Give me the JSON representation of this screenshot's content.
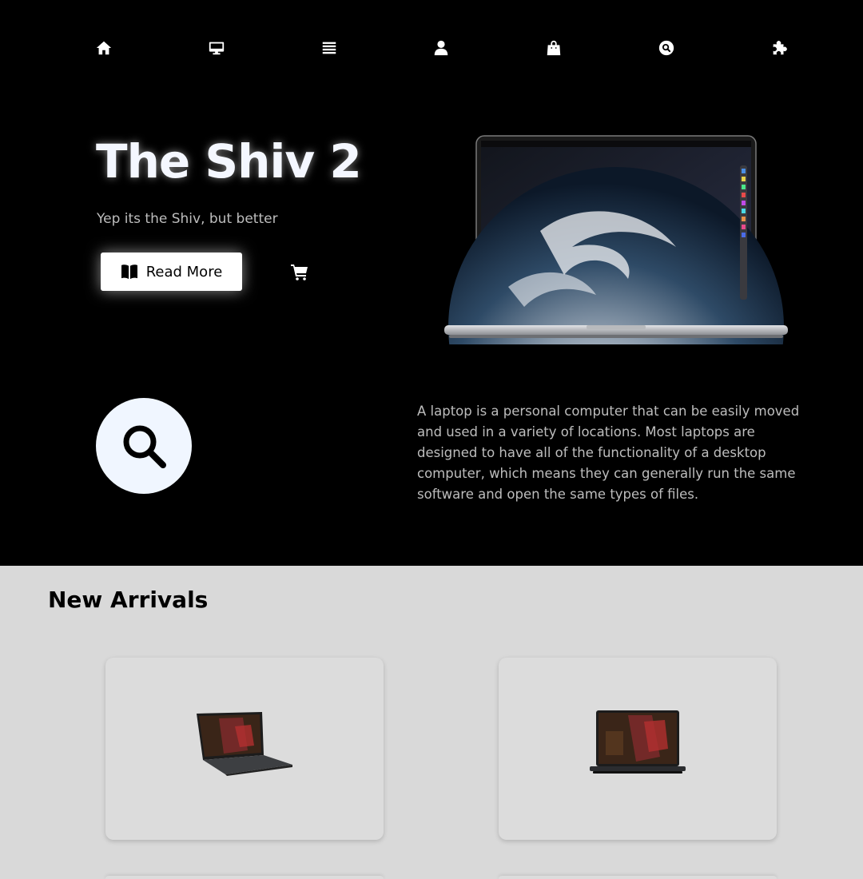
{
  "nav": {
    "items": [
      {
        "icon": "home-icon"
      },
      {
        "icon": "monitor-icon"
      },
      {
        "icon": "server-icon"
      },
      {
        "icon": "user-icon"
      },
      {
        "icon": "shopping-bag-icon"
      },
      {
        "icon": "search-circle-icon"
      },
      {
        "icon": "puzzle-icon"
      }
    ]
  },
  "hero": {
    "title": "The Shiv 2",
    "subtitle": "Yep its the Shiv, but better",
    "read_more_label": "Read More",
    "read_more_icon": "book-open-icon",
    "cart_icon": "cart-icon"
  },
  "info": {
    "icon": "search-icon",
    "description": "A laptop is a personal computer that can be easily moved and used in a variety of locations. Most laptops are designed to have all of the functionality of a desktop computer, which means they can generally run the same software and open the same types of files."
  },
  "new_arrivals": {
    "title": "New Arrivals",
    "cards": [
      {
        "image": "gaming-laptop-angled"
      },
      {
        "image": "gaming-laptop-front"
      }
    ]
  },
  "colors": {
    "hero_bg": "#000000",
    "section_bg": "#d9d9d9",
    "card_bg": "#dcdcdc",
    "accent_circle": "#f0f6ff"
  }
}
